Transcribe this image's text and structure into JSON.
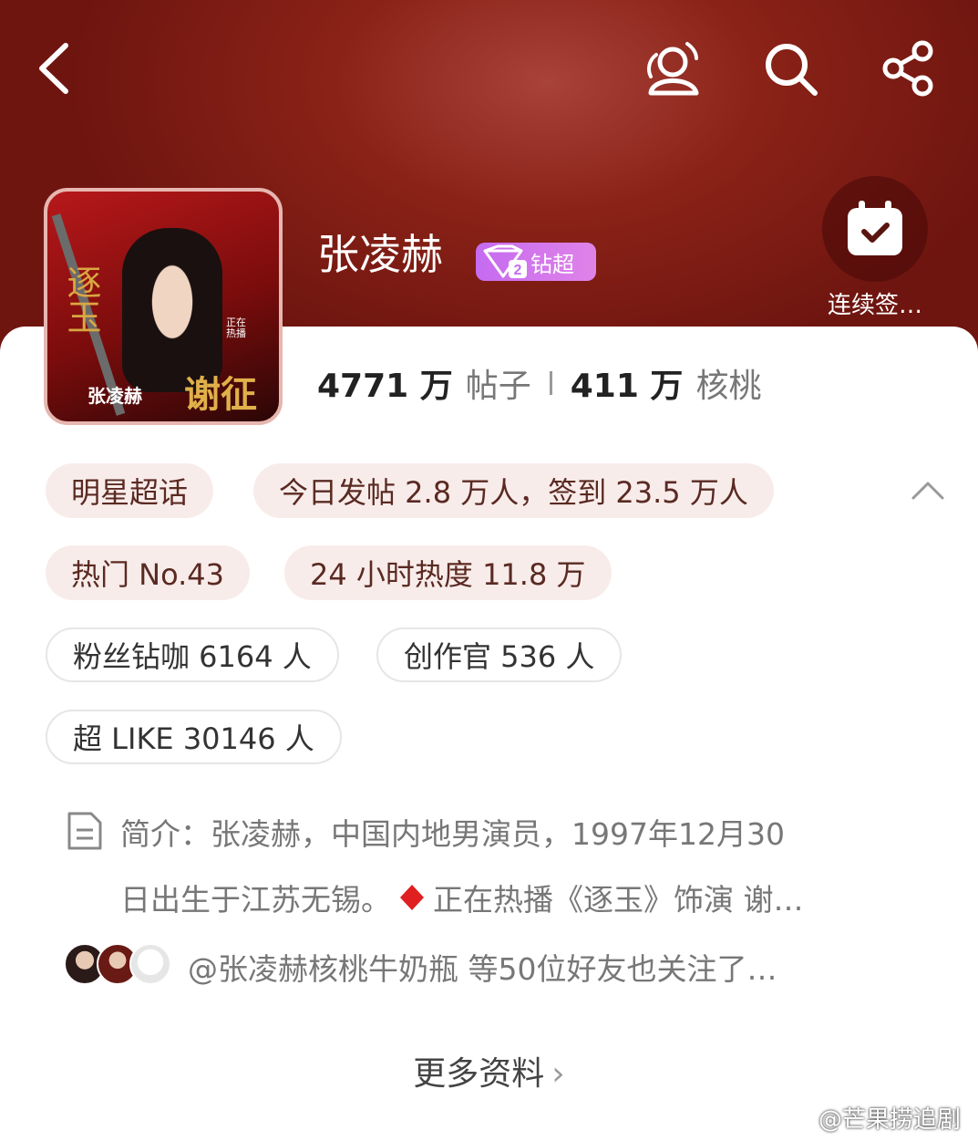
{
  "header": {
    "name": "张凌赫",
    "badge_label": "钻超",
    "badge_level": "2",
    "checkin_label": "连续签…"
  },
  "avatar_art": {
    "calligraphy_1": "逐玉",
    "calligraphy_2": "谢征",
    "caption": "张凌赫",
    "tag": "正在热播"
  },
  "stats": {
    "posts_value": "4771 万",
    "posts_label": "帖子",
    "walnuts_value": "411 万",
    "walnuts_label": "核桃"
  },
  "chips": [
    {
      "label": "明星超话"
    },
    {
      "label": "今日发帖 2.8 万人，签到 23.5 万人"
    },
    {
      "label": "热门 No.43"
    },
    {
      "label": "24 小时热度 11.8 万"
    },
    {
      "label": "粉丝钻咖 6164 人"
    },
    {
      "label": "创作官 536 人"
    },
    {
      "label": "超 LIKE 30146 人"
    }
  ],
  "intro": {
    "line1": "简介：张凌赫，中国内地男演员，1997年12月30",
    "line2_a": "日出生于江苏无锡。",
    "line2_b": "正在热播《逐玉》饰演 谢…"
  },
  "friends": {
    "text": "@张凌赫核桃牛奶瓶 等50位好友也关注了…"
  },
  "more": {
    "label": "更多资料",
    "chevron": "›"
  },
  "watermark": {
    "text": "@芒果捞追剧"
  },
  "icons": [
    "back-icon",
    "super-topic-icon",
    "search-icon",
    "share-icon",
    "calendar-check-icon",
    "document-icon",
    "diamond-icon",
    "chevron-up-icon",
    "chevron-right-icon",
    "weibo-logo-icon"
  ],
  "colors": {
    "header_red": "#8a2217",
    "badge_purple": "#c56bf0",
    "chip_pink": "#f8ecea",
    "diamond_red": "#e02020"
  }
}
